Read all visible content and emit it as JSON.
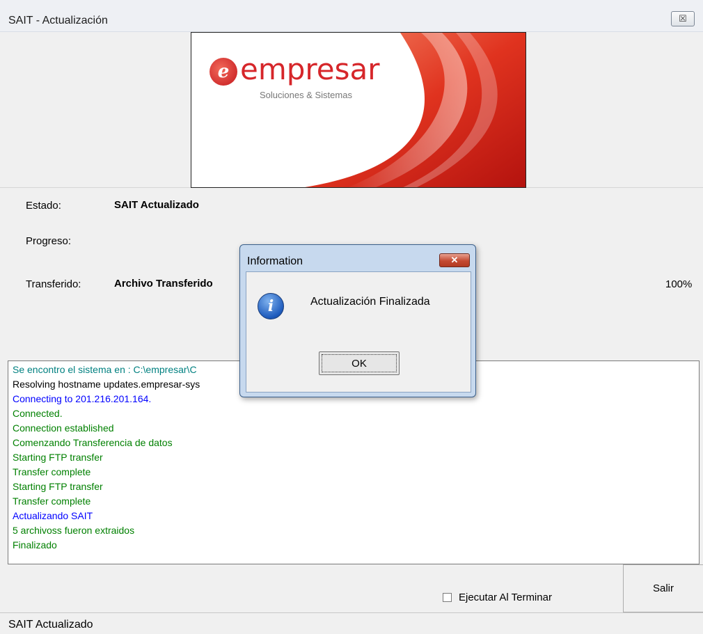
{
  "window": {
    "title": "SAIT - Actualización",
    "close_glyph": "☒"
  },
  "banner": {
    "logo_mark": "e",
    "logo_word": "empresar",
    "tagline": "Soluciones & Sistemas"
  },
  "info": {
    "estado_label": "Estado:",
    "estado_value": "SAIT Actualizado",
    "progreso_label": "Progreso:",
    "transferido_label": "Transferido:",
    "transferido_value": "Archivo Transferido",
    "percent": "100%"
  },
  "log": {
    "lines": [
      {
        "text": "Se encontro el sistema en : C:\\empresar\\C",
        "color": "#008080"
      },
      {
        "text": "Resolving hostname updates.empresar-sys",
        "color": "#000000"
      },
      {
        "text": "Connecting to 201.216.201.164.",
        "color": "#0000ff"
      },
      {
        "text": "Connected.",
        "color": "#008000"
      },
      {
        "text": "Connection established",
        "color": "#008000"
      },
      {
        "text": "Comenzando Transferencia de datos",
        "color": "#008000"
      },
      {
        "text": "Starting FTP transfer",
        "color": "#008000"
      },
      {
        "text": "Transfer complete",
        "color": "#008000"
      },
      {
        "text": "Starting FTP transfer",
        "color": "#008000"
      },
      {
        "text": "Transfer complete",
        "color": "#008000"
      },
      {
        "text": "Actualizando SAIT",
        "color": "#0000ff"
      },
      {
        "text": "5 archivoss fueron extraidos",
        "color": "#008000"
      },
      {
        "text": "Finalizado",
        "color": "#008000"
      }
    ]
  },
  "bottom": {
    "checkbox_label": "Ejecutar Al Terminar",
    "checkbox_checked": false,
    "exit_button": "Salir"
  },
  "statusbar": {
    "text": "SAIT Actualizado"
  },
  "dialog": {
    "title": "Information",
    "close_glyph": "✕",
    "icon": "information-icon",
    "icon_glyph": "i",
    "message": "Actualización Finalizada",
    "ok_button": "OK"
  }
}
